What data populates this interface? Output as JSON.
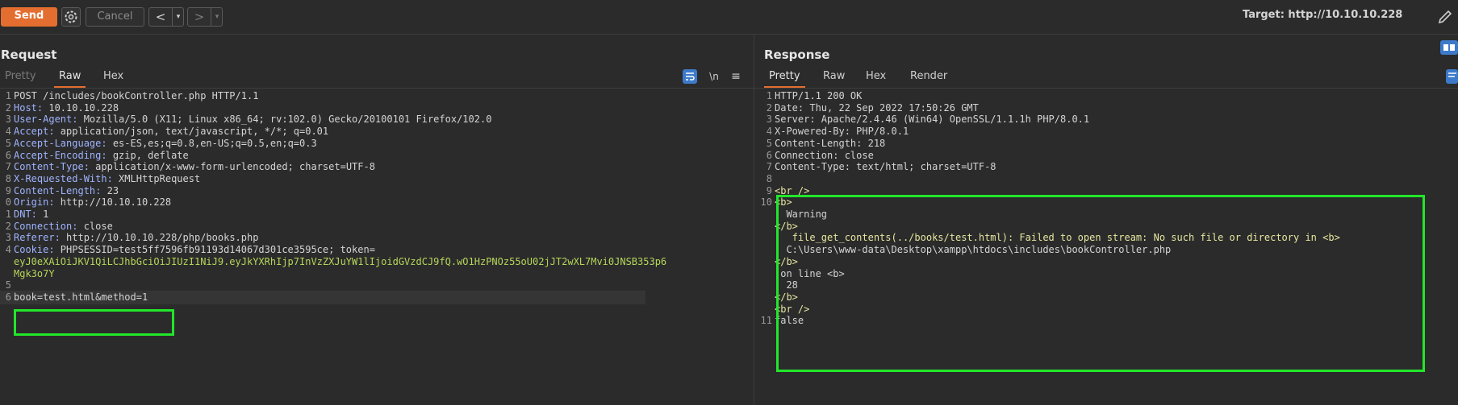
{
  "toolbar": {
    "send_label": "Send",
    "cancel_label": "Cancel",
    "prev_label": "<",
    "next_label": ">",
    "dropdown_label": "▾",
    "target_label": "Target: http://10.10.10.228"
  },
  "request": {
    "title": "Request",
    "tabs": [
      "Pretty",
      "Raw",
      "Hex"
    ],
    "newline_label": "\\n",
    "menu_label": "≡",
    "lines": [
      {
        "n": "1",
        "k": "",
        "v": "POST /includes/bookController.php HTTP/1.1"
      },
      {
        "n": "2",
        "k": "Host: ",
        "v": "10.10.10.228"
      },
      {
        "n": "3",
        "k": "User-Agent: ",
        "v": "Mozilla/5.0 (X11; Linux x86_64; rv:102.0) Gecko/20100101 Firefox/102.0"
      },
      {
        "n": "4",
        "k": "Accept: ",
        "v": "application/json, text/javascript, */*; q=0.01"
      },
      {
        "n": "5",
        "k": "Accept-Language: ",
        "v": "es-ES,es;q=0.8,en-US;q=0.5,en;q=0.3"
      },
      {
        "n": "6",
        "k": "Accept-Encoding: ",
        "v": "gzip, deflate"
      },
      {
        "n": "7",
        "k": "Content-Type: ",
        "v": "application/x-www-form-urlencoded; charset=UTF-8"
      },
      {
        "n": "8",
        "k": "X-Requested-With: ",
        "v": "XMLHttpRequest"
      },
      {
        "n": "9",
        "k": "Content-Length: ",
        "v": "23"
      },
      {
        "n": "0",
        "k": "Origin: ",
        "v": "http://10.10.10.228"
      },
      {
        "n": "1",
        "k": "DNT: ",
        "v": "1"
      },
      {
        "n": "2",
        "k": "Connection: ",
        "v": "close"
      },
      {
        "n": "3",
        "k": "Referer: ",
        "v": "http://10.10.10.228/php/books.php"
      },
      {
        "n": "4",
        "k": "Cookie: ",
        "v": "PHPSESSID=test5ff7596fb91193d14067d301ce3595ce; token="
      },
      {
        "n": "",
        "k": "",
        "v": "eyJ0eXAiOiJKV1QiLCJhbGciOiJIUzI1NiJ9.eyJkYXRhIjp7InVzZXJuYW1lIjoidGVzdCJ9fQ.wO1HzPNOz55oU02jJT2wXL7Mvi0JNSB353p6"
      },
      {
        "n": "",
        "k": "",
        "v": "Mgk3o7Y"
      },
      {
        "n": "5",
        "k": "",
        "v": ""
      },
      {
        "n": "6",
        "k": "",
        "v": "book=test.html&method=1"
      }
    ]
  },
  "response": {
    "title": "Response",
    "tabs": [
      "Pretty",
      "Raw",
      "Hex",
      "Render"
    ],
    "lines": [
      {
        "n": "1",
        "v": "HTTP/1.1 200 OK"
      },
      {
        "n": "2",
        "v": "Date: Thu, 22 Sep 2022 17:50:26 GMT"
      },
      {
        "n": "3",
        "v": "Server: Apache/2.4.46 (Win64) OpenSSL/1.1.1h PHP/8.0.1"
      },
      {
        "n": "4",
        "v": "X-Powered-By: PHP/8.0.1"
      },
      {
        "n": "5",
        "v": "Content-Length: 218"
      },
      {
        "n": "6",
        "v": "Connection: close"
      },
      {
        "n": "7",
        "v": "Content-Type: text/html; charset=UTF-8"
      },
      {
        "n": "8",
        "v": ""
      },
      {
        "n": "9",
        "v": "<br />"
      },
      {
        "n": "10",
        "v": "<b>"
      },
      {
        "n": "",
        "v": "  Warning"
      },
      {
        "n": "",
        "v": "</b>"
      },
      {
        "n": "",
        "v": ":  file_get_contents(../books/test.html): Failed to open stream: No such file or directory in <b>"
      },
      {
        "n": "",
        "v": "  C:\\Users\\www-data\\Desktop\\xampp\\htdocs\\includes\\bookController.php"
      },
      {
        "n": "",
        "v": "</b>"
      },
      {
        "n": "",
        "v": " on line <b>"
      },
      {
        "n": "",
        "v": "  28"
      },
      {
        "n": "",
        "v": "</b>"
      },
      {
        "n": "",
        "v": "<br />"
      },
      {
        "n": "11",
        "v": "false"
      }
    ]
  },
  "colors": {
    "accent": "#e46e2f",
    "highlight_box": "#22e62a"
  }
}
